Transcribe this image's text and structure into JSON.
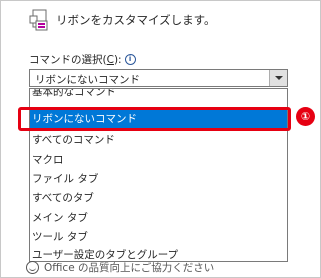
{
  "header": {
    "text": "リボンをカスタマイズします。",
    "icon": "customize-ribbon-icon"
  },
  "section": {
    "label_prefix": "コマンドの選択(",
    "label_access": "C",
    "label_suffix": "):",
    "info_icon": "info-icon"
  },
  "combo": {
    "value": "リボンにないコマンド"
  },
  "dropdown": {
    "options": [
      "基本的なコマンド",
      "リボンにないコマンド",
      "すべてのコマンド",
      "マクロ",
      "ファイル タブ",
      "すべてのタブ",
      "メイン タブ",
      "ツール タブ",
      "ユーザー設定のタブとグループ"
    ],
    "selected_index": 1
  },
  "callout": {
    "badge": "①",
    "color": "#e60012"
  },
  "below": {
    "text": "Office の品質向上にご協力ください"
  },
  "colors": {
    "selection": "#0078d7",
    "accent": "#2b579a"
  }
}
